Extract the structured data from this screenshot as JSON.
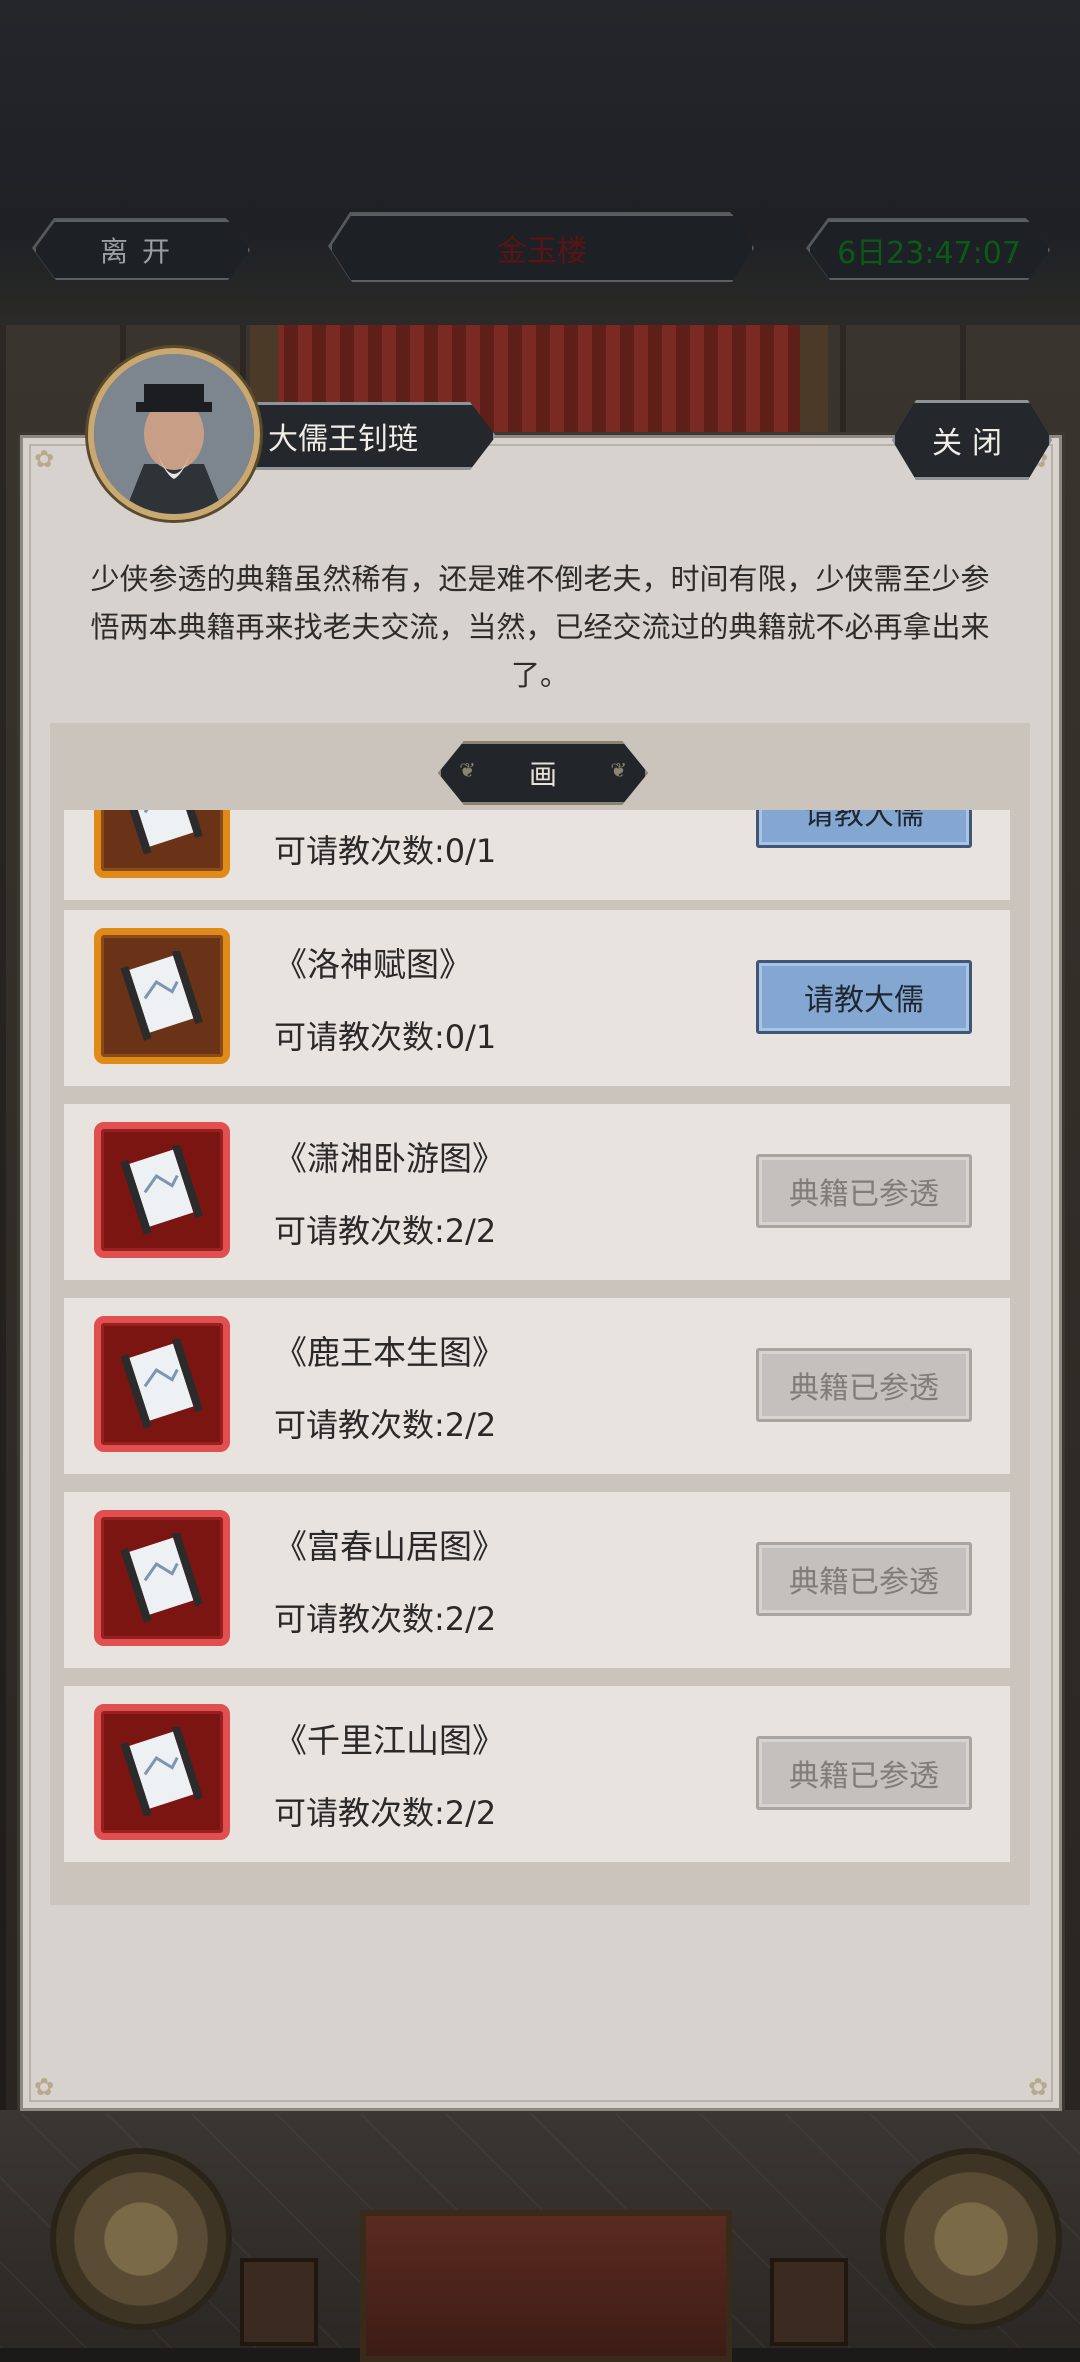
{
  "topbar": {
    "leave_label": "离开",
    "place_name": "金玉楼",
    "timer": "6日23:47:07"
  },
  "dialog": {
    "npc_name": "大儒王钊琏",
    "close_label": "关闭",
    "description": "少侠参透的典籍虽然稀有，还是难不倒老夫，时间有限，少侠需至少参悟两本典籍再来找老夫交流，当然，已经交流过的典籍就不必再拿出来了。",
    "category": "画"
  },
  "items": [
    {
      "title": "",
      "count": "可请教次数:0/1",
      "rarity": "orange",
      "action": "请教大儒",
      "state": "active"
    },
    {
      "title": "《洛神赋图》",
      "count": "可请教次数:0/1",
      "rarity": "orange",
      "action": "请教大儒",
      "state": "active"
    },
    {
      "title": "《潇湘卧游图》",
      "count": "可请教次数:2/2",
      "rarity": "red",
      "action": "典籍已参透",
      "state": "done"
    },
    {
      "title": "《鹿王本生图》",
      "count": "可请教次数:2/2",
      "rarity": "red",
      "action": "典籍已参透",
      "state": "done"
    },
    {
      "title": "《富春山居图》",
      "count": "可请教次数:2/2",
      "rarity": "red",
      "action": "典籍已参透",
      "state": "done"
    },
    {
      "title": "《千里江山图》",
      "count": "可请教次数:2/2",
      "rarity": "red",
      "action": "典籍已参透",
      "state": "done"
    }
  ],
  "colors": {
    "rarity_orange": "#e08a18",
    "rarity_red": "#e05050",
    "button_active": "#84a7d1",
    "button_done": "#c3c0bd",
    "timer_green": "#0c5a17",
    "place_red": "#5a1414"
  }
}
